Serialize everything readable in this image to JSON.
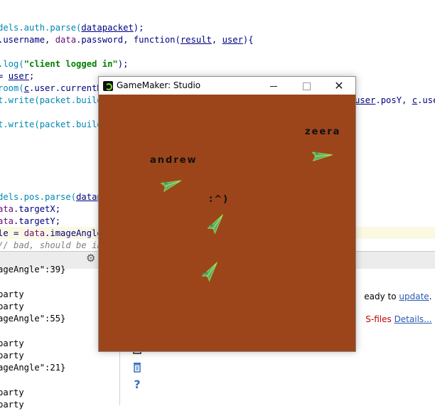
{
  "ide": {
    "code_lines": [
      [
        {
          "t": "dels.auth.parse(",
          "c": "k-teal"
        },
        {
          "t": "datapacket",
          "c": "u"
        },
        {
          "t": ");",
          "c": ""
        }
      ],
      [
        {
          "t": ".username, ",
          "c": ""
        },
        {
          "t": "data",
          "c": "k-purple"
        },
        {
          "t": ".password, ",
          "c": ""
        },
        {
          "t": "function",
          "c": "k-blue"
        },
        {
          "t": "(",
          "c": ""
        },
        {
          "t": "result",
          "c": "u"
        },
        {
          "t": ", ",
          "c": ""
        },
        {
          "t": "user",
          "c": "u"
        },
        {
          "t": "){",
          "c": ""
        }
      ],
      [
        {
          "t": "",
          "c": ""
        }
      ],
      [
        {
          "t": ".log(",
          "c": "k-teal"
        },
        {
          "t": "\"client logged in\"",
          "c": "k-green"
        },
        {
          "t": ");",
          "c": ""
        }
      ],
      [
        {
          "t": "= ",
          "c": ""
        },
        {
          "t": "user",
          "c": "u"
        },
        {
          "t": ";",
          "c": ""
        }
      ],
      [
        {
          "t": "room(",
          "c": "k-teal"
        },
        {
          "t": "c",
          "c": "u"
        },
        {
          "t": ".user.currentR",
          "c": ""
        }
      ],
      [
        {
          "t": "t.write(packet.build",
          "c": "k-teal"
        }
      ],
      [
        {
          "t": "",
          "c": ""
        }
      ],
      [
        {
          "t": "t.write(packet.build",
          "c": "k-teal"
        }
      ],
      [
        {
          "t": "",
          "c": ""
        }
      ],
      [
        {
          "t": "",
          "c": ""
        }
      ],
      [
        {
          "t": "",
          "c": ""
        }
      ],
      [
        {
          "t": "",
          "c": ""
        }
      ],
      [
        {
          "t": "",
          "c": ""
        }
      ],
      [
        {
          "t": "dels.pos.parse(",
          "c": "k-teal"
        },
        {
          "t": "datap",
          "c": "u"
        }
      ],
      [
        {
          "t": "ata",
          "c": "k-purple"
        },
        {
          "t": ".targetX;",
          "c": ""
        }
      ],
      [
        {
          "t": "ata",
          "c": "k-purple"
        },
        {
          "t": ".targetY;",
          "c": ""
        }
      ],
      [
        {
          "t": "le = ",
          "c": ""
        },
        {
          "t": "data",
          "c": "k-purple"
        },
        {
          "t": ".imageAngle",
          "c": ""
        }
      ],
      [
        {
          "t": "// bad, should be in",
          "c": "k-gray"
        }
      ]
    ],
    "right_code_fragment": [
      {
        "t": "user",
        "c": "u"
      },
      {
        "t": ".posY, ",
        "c": ""
      },
      {
        "t": "c",
        "c": "u"
      },
      {
        "t": ".use",
        "c": ""
      }
    ],
    "console_lines": [
      "ageAngle\":39}",
      "",
      "party",
      "party",
      "ageAngle\":55}",
      "",
      "party",
      "party",
      "ageAngle\":21}",
      "",
      "party",
      "party"
    ],
    "notice_update": {
      "pre": "eady to ",
      "link": "update",
      "post": "."
    },
    "notice_files": {
      "red": "S-files ",
      "link": "Details..."
    }
  },
  "window": {
    "title": "GameMaker: Studio",
    "close_glyph": "✕"
  },
  "game": {
    "background_color": "#9c451b",
    "players": [
      {
        "name": "zeera",
        "angle": -5
      },
      {
        "name": "andrew",
        "angle": -20
      },
      {
        "name": ":^)",
        "angle": -55
      },
      {
        "name": "",
        "angle": -55
      }
    ]
  }
}
